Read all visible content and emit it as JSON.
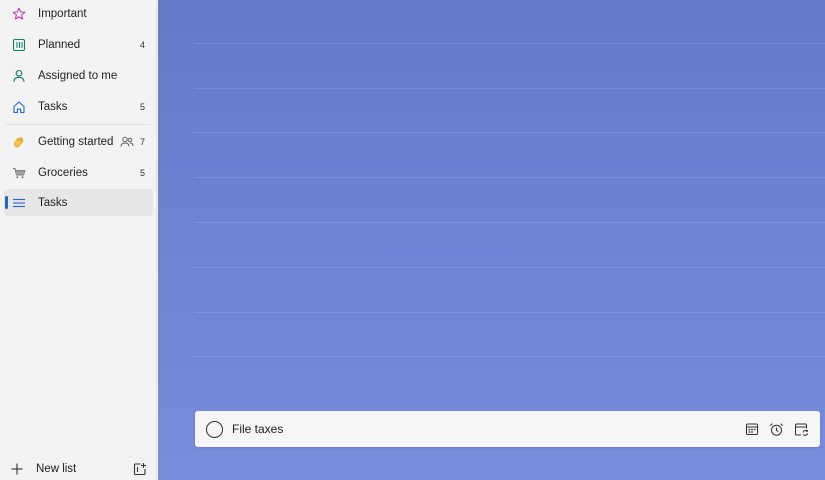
{
  "sidebar": {
    "items": [
      {
        "label": "Important",
        "icon": "star-icon",
        "count": "",
        "color": "#c239b3"
      },
      {
        "label": "Planned",
        "icon": "calendar-grid-icon",
        "count": "4",
        "color": "#0f7b6c"
      },
      {
        "label": "Assigned to me",
        "icon": "person-icon",
        "count": "",
        "color": "#0f7b6c"
      },
      {
        "label": "Tasks",
        "icon": "home-icon",
        "count": "5",
        "color": "#2564cf"
      }
    ],
    "lists": [
      {
        "label": "Getting started",
        "icon": "waving-hand-icon",
        "count": "7",
        "shared": true
      },
      {
        "label": "Groceries",
        "icon": "shopping-cart-icon",
        "count": "5",
        "shared": false
      },
      {
        "label": "Tasks",
        "icon": "list-lines-icon",
        "count": "",
        "selected": true
      }
    ],
    "new_list_label": "New list"
  },
  "main": {
    "add_task_value": "File taxes",
    "accent": "#2564cf",
    "background": "#6d84d3"
  }
}
